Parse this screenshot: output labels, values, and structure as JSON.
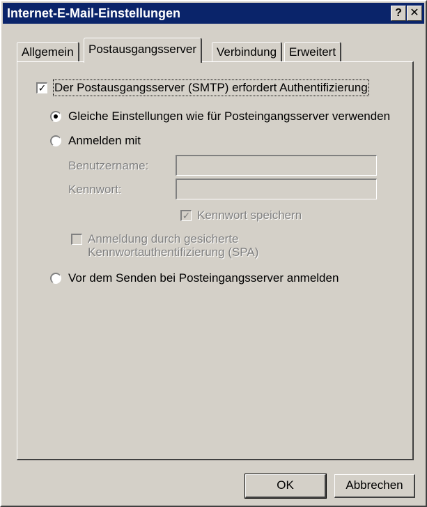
{
  "window": {
    "title": "Internet-E-Mail-Einstellungen",
    "help_glyph": "?",
    "close_glyph": "✕"
  },
  "tabs": [
    {
      "label": "Allgemein"
    },
    {
      "label": "Postausgangsserver"
    },
    {
      "label": "Verbindung"
    },
    {
      "label": "Erweitert"
    }
  ],
  "smtp_auth": {
    "label": "Der Postausgangsserver (SMTP) erfordert Authentifizierung",
    "checked": true
  },
  "options": {
    "same_settings": {
      "label": "Gleiche Einstellungen wie für Posteingangsserver verwenden",
      "selected": true
    },
    "login_with": {
      "label": "Anmelden mit",
      "selected": false
    },
    "login_before_send": {
      "label": "Vor dem Senden bei Posteingangsserver anmelden",
      "selected": false
    }
  },
  "fields": {
    "username_label": "Benutzername:",
    "username_value": "",
    "password_label": "Kennwort:",
    "password_value": ""
  },
  "save_password": {
    "label": "Kennwort speichern",
    "checked": true
  },
  "spa": {
    "line1": "Anmeldung durch gesicherte",
    "line2": "Kennwortauthentifizierung (SPA)",
    "checked": false
  },
  "buttons": {
    "ok": "OK",
    "cancel": "Abbrechen"
  }
}
